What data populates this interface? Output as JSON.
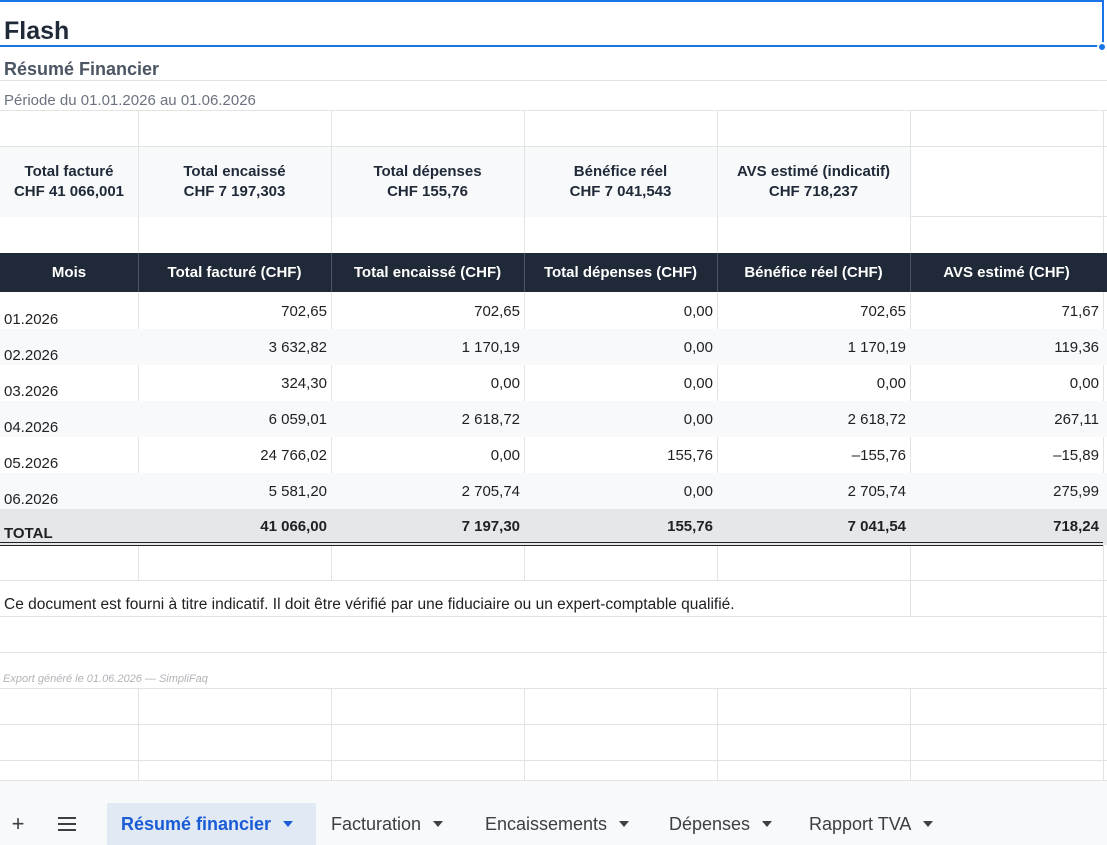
{
  "title": "Flash",
  "subtitle": "Résumé Financier",
  "period": "Période du 01.01.2026 au 01.06.2026",
  "kpis": [
    {
      "label": "Total facturé",
      "value": "CHF 41 066,001"
    },
    {
      "label": "Total encaissé",
      "value": "CHF 7 197,303"
    },
    {
      "label": "Total dépenses",
      "value": "CHF 155,76"
    },
    {
      "label": "Bénéfice réel",
      "value": "CHF 7 041,543"
    },
    {
      "label": "AVS estimé (indicatif)",
      "value": "CHF 718,237"
    }
  ],
  "table": {
    "headers": [
      "Mois",
      "Total facturé (CHF)",
      "Total encaissé (CHF)",
      "Total dépenses (CHF)",
      "Bénéfice réel (CHF)",
      "AVS estimé (CHF)"
    ],
    "rows": [
      [
        "01.2026",
        "702,65",
        "702,65",
        "0,00",
        "702,65",
        "71,67"
      ],
      [
        "02.2026",
        "3 632,82",
        "1 170,19",
        "0,00",
        "1 170,19",
        "119,36"
      ],
      [
        "03.2026",
        "324,30",
        "0,00",
        "0,00",
        "0,00",
        "0,00"
      ],
      [
        "04.2026",
        "6 059,01",
        "2 618,72",
        "0,00",
        "2 618,72",
        "267,11"
      ],
      [
        "05.2026",
        "24 766,02",
        "0,00",
        "155,76",
        "–155,76",
        "–15,89"
      ],
      [
        "06.2026",
        "5 581,20",
        "2 705,74",
        "0,00",
        "2 705,74",
        "275,99"
      ]
    ],
    "total": [
      "TOTAL",
      "41 066,00",
      "7 197,30",
      "155,76",
      "7 041,54",
      "718,24"
    ]
  },
  "disclaimer": "Ce document est fourni à titre indicatif. Il doit être vérifié par une fiduciaire ou un expert-comptable qualifié.",
  "export_note": "Export généré le 01.06.2026 — SimpliFaq",
  "tabs": {
    "add_icon": "+",
    "items": [
      {
        "label": "Résumé financier",
        "active": true
      },
      {
        "label": "Facturation",
        "active": false
      },
      {
        "label": "Encaissements",
        "active": false
      },
      {
        "label": "Dépenses",
        "active": false
      },
      {
        "label": "Rapport TVA",
        "active": false
      }
    ]
  }
}
